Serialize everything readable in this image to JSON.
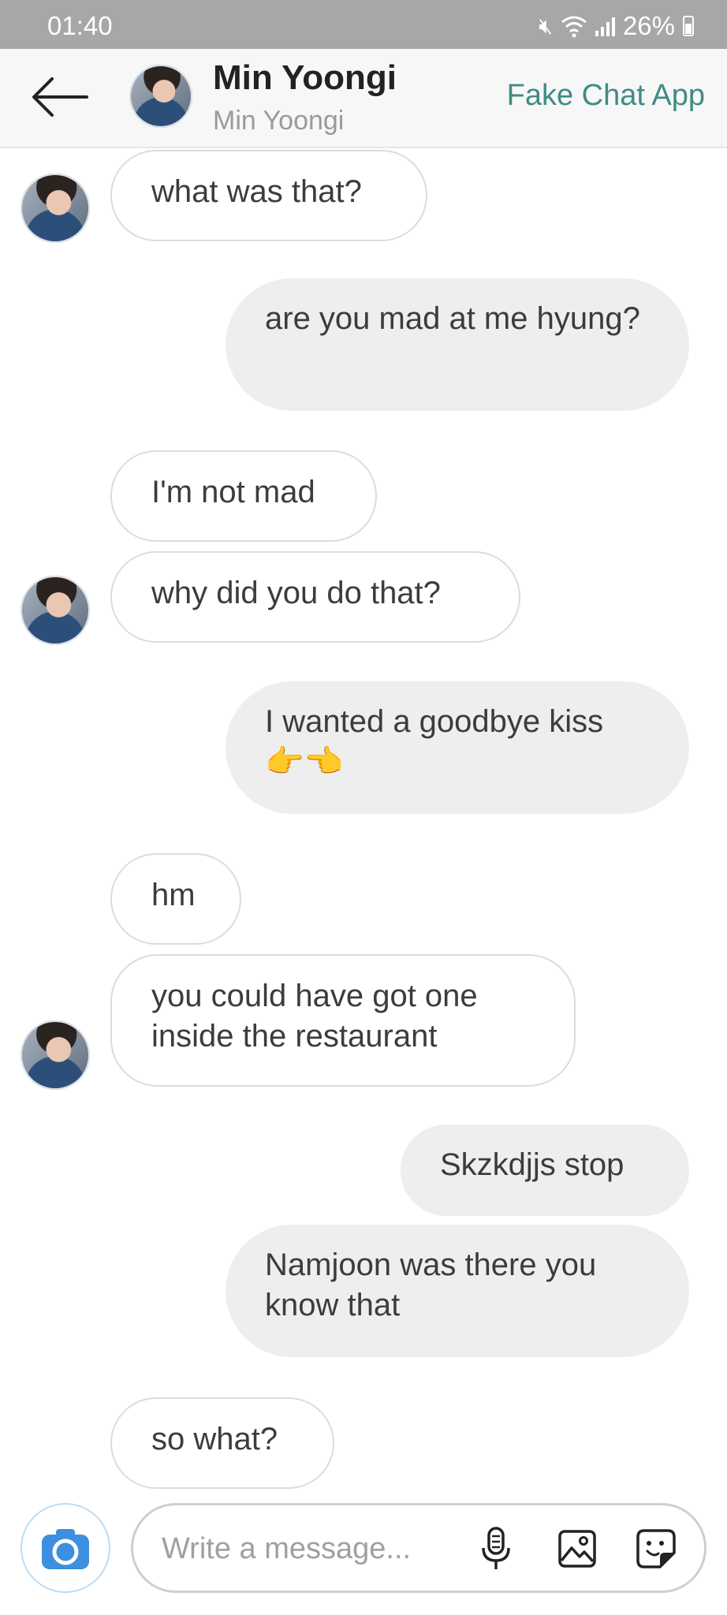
{
  "status_bar": {
    "time": "01:40",
    "battery": "26%"
  },
  "header": {
    "contact_name": "Min Yoongi",
    "contact_subtitle": "Min Yoongi",
    "app_name": "Fake Chat App"
  },
  "messages": [
    {
      "side": "incoming",
      "text": "what was that?"
    },
    {
      "side": "outgoing",
      "text": "are you mad at me hyung?"
    },
    {
      "side": "incoming",
      "text": "I'm not mad"
    },
    {
      "side": "incoming",
      "text": "why did you do that?"
    },
    {
      "side": "outgoing",
      "text": "I wanted a goodbye kiss 👉👈"
    },
    {
      "side": "incoming",
      "text": "hm"
    },
    {
      "side": "incoming",
      "text": "you could have got one inside the restaurant"
    },
    {
      "side": "outgoing",
      "text": "Skzkdjjs stop"
    },
    {
      "side": "outgoing",
      "text": "Namjoon was there you know that"
    },
    {
      "side": "incoming",
      "text": "so what?"
    }
  ],
  "composer": {
    "placeholder": "Write a message..."
  },
  "colors": {
    "accent": "#3f8c84",
    "outgoing_bubble": "#eeeeee",
    "camera_blue": "#3d8fe0"
  },
  "icons": [
    "back-arrow-icon",
    "mute-icon",
    "wifi-icon",
    "signal-icon",
    "battery-icon",
    "camera-icon",
    "microphone-icon",
    "image-icon",
    "sticker-icon"
  ]
}
